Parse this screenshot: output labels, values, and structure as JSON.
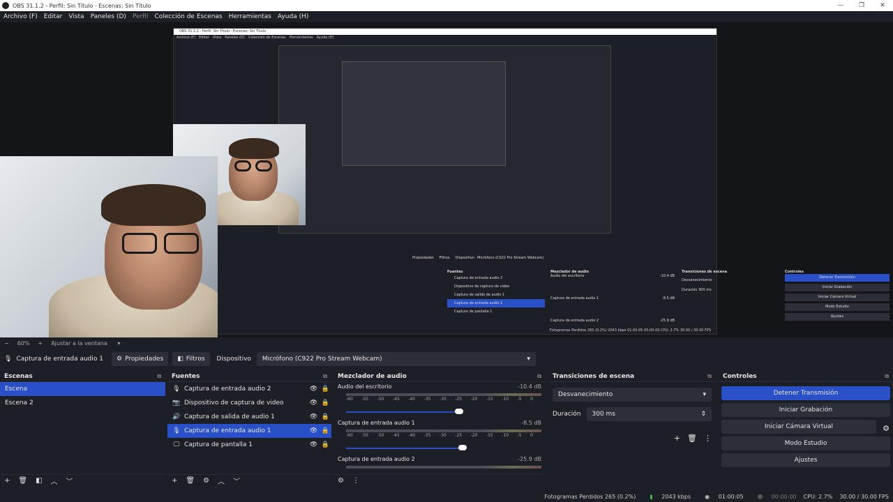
{
  "window": {
    "title": "OBS 31.1.2 - Perfil: Sin Título - Escenas: Sin Título",
    "minimize": "—",
    "maximize": "❐",
    "close": "✕"
  },
  "menu": [
    "Archivo (F)",
    "Editar",
    "Vista",
    "Paneles (D)",
    "Perfil",
    "Colección de Escenas",
    "Herramientas",
    "Ayuda (H)"
  ],
  "nested": {
    "title": "OBS 31.1.2 - Perfil: Sin Título - Escenas: Sin Título",
    "menu": [
      "Archivo (F)",
      "Editar",
      "Vista",
      "Paneles (D)",
      "Colección de Escenas",
      "Herramientas",
      "Ayuda (H)"
    ],
    "toolbar": {
      "props": "Propiedades",
      "filters": "Filtros",
      "device": "Dispositivo",
      "device_value": "Micrófono (C922 Pro Stream Webcam)"
    },
    "sources_head": "Fuentes",
    "sources": [
      "Captura de entrada audio 2",
      "Dispositivo de captura de video",
      "Captura de salida de audio 1",
      "Captura de entrada audio 1",
      "Captura de pantalla 1"
    ],
    "mixer_head": "Mezclador de audio",
    "mixer": [
      {
        "name": "Audio del escritorio",
        "db": "-10.4 dB"
      },
      {
        "name": "Captura de entrada audio 1",
        "db": "-8.5 dB"
      },
      {
        "name": "Captura de entrada audio 2",
        "db": "-25.9 dB"
      }
    ],
    "trans_head": "Transiciones de escena",
    "trans_value": "Desvanecimiento",
    "duration_label": "Duración",
    "duration_value": "300 ms",
    "controls_head": "Controles",
    "controls": [
      "Detener Transmisión",
      "Iniciar Grabación",
      "Iniciar Cámara Virtual",
      "Modo Estudio",
      "Ajustes"
    ],
    "status": "Fotogramas Perdidos 265 (0.2%)   2043 kbps   01:00:05   00:00:00   CPU: 2.7%   30.00 / 30.00 FPS"
  },
  "zoom": {
    "value": "60%",
    "fit": "Ajustar a la ventana"
  },
  "source_toolbar": {
    "selected_source": "Captura de entrada audio 1",
    "properties": "Propiedades",
    "filters": "Filtros",
    "device_label": "Dispositivo",
    "device_value": "Micrófono (C922 Pro Stream Webcam)"
  },
  "scenes": {
    "title": "Escenas",
    "items": [
      "Escena",
      "Escena 2"
    ],
    "selected": 0
  },
  "sources": {
    "title": "Fuentes",
    "items": [
      {
        "label": "Captura de entrada audio 2",
        "icon": "mic-icon"
      },
      {
        "label": "Dispositivo de captura de video",
        "icon": "camera-icon"
      },
      {
        "label": "Captura de salida de audio 1",
        "icon": "speaker-icon"
      },
      {
        "label": "Captura de entrada audio 1",
        "icon": "mic-icon"
      },
      {
        "label": "Captura de pantalla 1",
        "icon": "monitor-icon"
      }
    ],
    "selected": 3
  },
  "mixer": {
    "title": "Mezclador de audio",
    "ticks": [
      "-60",
      "-55",
      "-50",
      "-45",
      "-40",
      "-35",
      "-30",
      "-25",
      "-20",
      "-15",
      "-10",
      "-5",
      "0"
    ],
    "channels": [
      {
        "name": "Audio del escritorio",
        "db": "-10.4 dB",
        "volume": 0.9
      },
      {
        "name": "Captura de entrada audio 1",
        "db": "-8.5 dB",
        "volume": 0.93
      },
      {
        "name": "Captura de entrada audio 2",
        "db": "-25.9 dB",
        "volume": 0.9
      }
    ]
  },
  "transitions": {
    "title": "Transiciones de escena",
    "type": "Desvanecimiento",
    "duration_label": "Duración",
    "duration_value": "300 ms"
  },
  "controls": {
    "title": "Controles",
    "stop_stream": "Detener Transmisión",
    "start_record": "Iniciar Grabación",
    "virtual_cam": "Iniciar Cámara Virtual",
    "studio_mode": "Modo Estudio",
    "settings": "Ajustes"
  },
  "status": {
    "dropped_frames": "Fotogramas Perdidos 265 (0.2%)",
    "bitrate": "2043 kbps",
    "stream_time": "01:00:05",
    "record_time": "00:00:00",
    "cpu": "CPU: 2.7%",
    "fps": "30.00 / 30.00 FPS"
  },
  "colors": {
    "accent": "#2a50c8",
    "background": "#1d1f26",
    "panel": "#2c2f38"
  }
}
